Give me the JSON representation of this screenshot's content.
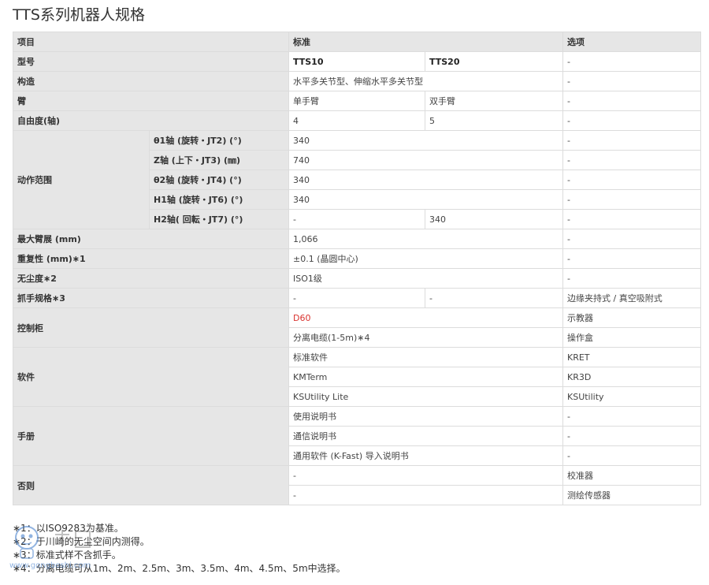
{
  "title": "TTS系列机器人规格",
  "header": {
    "item": "项目",
    "standard": "标准",
    "option": "选项"
  },
  "rows": {
    "model": {
      "label": "型号",
      "v1": "TTS10",
      "v2": "TTS20",
      "opt": "-"
    },
    "structure": {
      "label": "构造",
      "v": "水平多关节型、伸缩水平多关节型",
      "opt": "-"
    },
    "arm": {
      "label": "臂",
      "v1": "单手臂",
      "v2": "双手臂",
      "opt": "-"
    },
    "dof": {
      "label": "自由度(轴)",
      "v1": "4",
      "v2": "5",
      "opt": "-"
    },
    "motion": {
      "label": "动作范围",
      "items": [
        {
          "sub": "θ1轴 (旋转・JT2) (°)",
          "v": "340",
          "opt": "-"
        },
        {
          "sub": "Z轴 (上下・JT3) (㎜)",
          "v": "740",
          "opt": "-"
        },
        {
          "sub": "θ2轴 (旋转・JT4) (°)",
          "v": "340",
          "opt": "-"
        },
        {
          "sub": "H1轴 (旋转・JT6) (°)",
          "v": "340",
          "opt": "-"
        },
        {
          "sub": "H2轴( 回転・JT7) (°)",
          "v1": "-",
          "v2": "340",
          "opt": "-"
        }
      ]
    },
    "reach": {
      "label": "最大臂展 (mm)",
      "v": "1,066",
      "opt": "-"
    },
    "repeat": {
      "label": "重复性 (mm)∗1",
      "v": "±0.1 (晶圆中心)",
      "opt": "-"
    },
    "clean": {
      "label": "无尘度∗2",
      "v": "ISO1级",
      "opt": "-"
    },
    "hand": {
      "label": "抓手规格∗3",
      "v1": "-",
      "v2": "-",
      "opt": "边缘夹持式 / 真空吸附式"
    },
    "controller": {
      "label": "控制柜",
      "r1": "D60",
      "r1opt": "示教器",
      "r2": "分离电缆(1-5m)∗4",
      "r2opt": "操作盒"
    },
    "software": {
      "label": "软件",
      "items": [
        {
          "v": "标准软件",
          "opt": "KRET"
        },
        {
          "v": "KMTerm",
          "opt": "KR3D"
        },
        {
          "v": "KSUtility Lite",
          "opt": "KSUtility"
        }
      ]
    },
    "manual": {
      "label": "手册",
      "items": [
        {
          "v": "使用说明书",
          "opt": "-"
        },
        {
          "v": "通信说明书",
          "opt": "-"
        },
        {
          "v": "通用软件 (K-Fast) 导入说明书",
          "opt": "-"
        }
      ]
    },
    "other": {
      "label": "否则",
      "items": [
        {
          "v": "-",
          "opt": "校准器"
        },
        {
          "v": "-",
          "opt": "测绘传感器"
        }
      ]
    }
  },
  "notes": [
    "∗1：以ISO9283为基准。",
    "∗2：于川崎的无尘空间内测得。",
    "∗3：标准式样不含抓手。",
    "∗4：分离电缆可从1m、2m、2.5m、3m、3.5m、4m、4.5m、5m中选择。"
  ],
  "watermark": {
    "text": "www.gongboshi.com"
  },
  "colors": {
    "header_bg": "#e6e6e6",
    "border": "#dcdcdc",
    "highlight": "#d9322e"
  }
}
